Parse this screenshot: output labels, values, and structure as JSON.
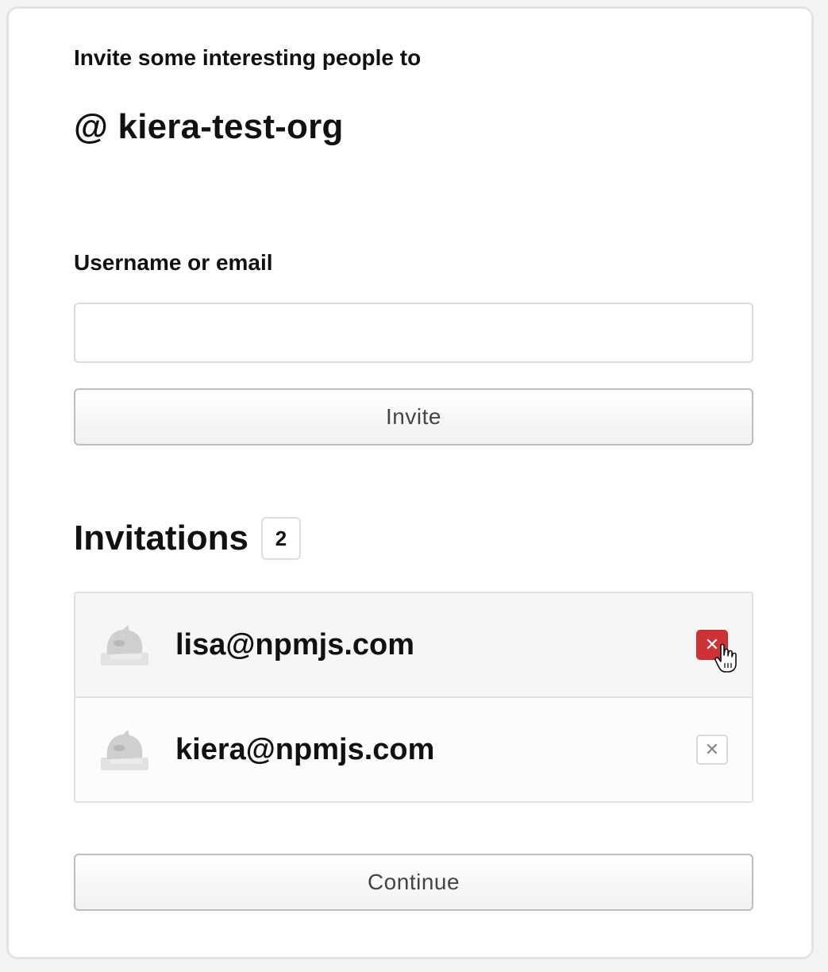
{
  "header": {
    "intro": "Invite some interesting people to",
    "org_prefix": "@",
    "org_name": "kiera-test-org",
    "org_display": "@ kiera-test-org"
  },
  "form": {
    "label": "Username or email",
    "value": "",
    "placeholder": "",
    "invite_label": "Invite"
  },
  "invitations": {
    "title": "Invitations",
    "count": "2",
    "items": [
      {
        "email": "lisa@npmjs.com",
        "remove_icon": "close-icon",
        "state": "hover"
      },
      {
        "email": "kiera@npmjs.com",
        "remove_icon": "close-icon",
        "state": "idle"
      }
    ]
  },
  "footer": {
    "continue_label": "Continue"
  },
  "colors": {
    "danger": "#cf3236",
    "border": "#e0e0e0",
    "text": "#111111"
  }
}
